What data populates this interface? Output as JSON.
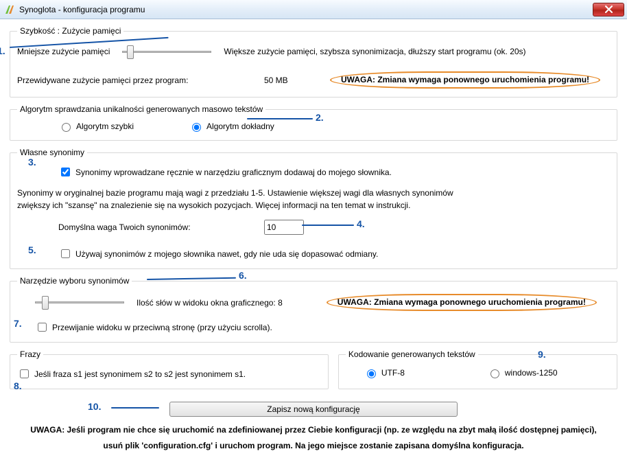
{
  "titlebar": {
    "title": "Synoglota - konfiguracja programu"
  },
  "speed_group": {
    "legend": "Szybkość : Zużycie pamięci",
    "less_label": "Mniejsze zużycie pamięci",
    "more_label": "Większe zużycie pamięci, szybsza synonimizacja, dłuższy start programu (ok. 20s)",
    "predicted_label": "Przewidywane zużycie pamięci przez program:",
    "predicted_value": "50 MB",
    "warning": "UWAGA: Zmiana wymaga ponownego uruchomienia programu!"
  },
  "algo_group": {
    "legend": "Algorytm sprawdzania unikalności generowanych masowo tekstów",
    "fast": "Algorytm szybki",
    "exact": "Algorytm dokładny"
  },
  "syn_group": {
    "legend": "Własne synonimy",
    "add_to_dict": "Synonimy wprowadzane ręcznie w narzędziu graficznym dodawaj do mojego słownika.",
    "desc_line1": "Synonimy w oryginalnej bazie programu mają wagi z przedziału 1-5. Ustawienie większej wagi dla własnych synonimów",
    "desc_line2": "zwiększy ich \"szansę\" na znalezienie się na wysokich pozycjach. Więcej informacji na ten temat w instrukcji.",
    "weight_label": "Domyślna waga Twoich synonimów:",
    "weight_value": "10",
    "use_own_label": "Używaj synonimów z mojego słownika nawet, gdy nie uda się dopasować odmiany."
  },
  "tool_group": {
    "legend": "Narzędzie wyboru synonimów",
    "count_label": "Ilość słów w widoku okna graficznego: 8",
    "warning": "UWAGA: Zmiana wymaga ponownego uruchomienia programu!",
    "reverse_scroll": "Przewijanie widoku w przeciwną stronę (przy użyciu scrolla)."
  },
  "phrases_group": {
    "legend": "Frazy",
    "sym_label": "Jeśli fraza s1 jest synonimem s2 to s2 jest synonimem s1."
  },
  "encoding_group": {
    "legend": "Kodowanie generowanych tekstów",
    "utf8": "UTF-8",
    "win1250": "windows-1250"
  },
  "save_label": "Zapisz nową konfigurację",
  "bottom_note_line1": "UWAGA: Jeśli program nie chce się uruchomić na zdefiniowanej przez Ciebie konfiguracji (np. ze względu na zbyt małą ilość dostępnej pamięci),",
  "bottom_note_line2": "usuń plik 'configuration.cfg' i uruchom program. Na jego miejsce zostanie zapisana domyślna konfiguracja.",
  "annotations": {
    "a1": "1.",
    "a2": "2.",
    "a3": "3.",
    "a4": "4.",
    "a5": "5.",
    "a6": "6.",
    "a7": "7.",
    "a8": "8.",
    "a9": "9.",
    "a10": "10."
  }
}
